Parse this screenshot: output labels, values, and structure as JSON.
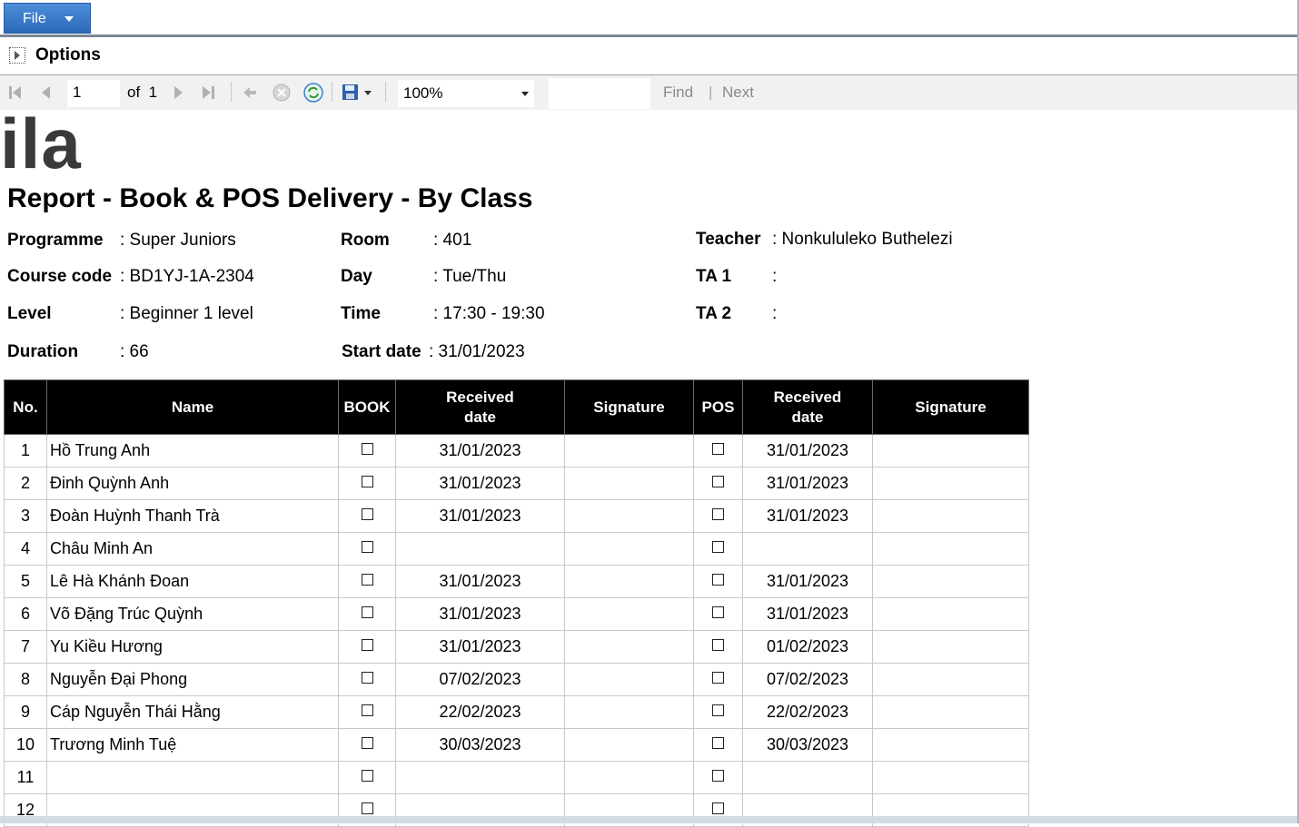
{
  "menu": {
    "file_label": "File"
  },
  "options": {
    "label": "Options"
  },
  "toolbar": {
    "page_current": "1",
    "page_of": "of",
    "page_total": "1",
    "zoom": "100%",
    "find_label": "Find",
    "find_sep": "|",
    "next_label": "Next"
  },
  "report": {
    "logo": "ila",
    "title": "Report - Book & POS Delivery - By Class",
    "info": {
      "programme_label": "Programme",
      "programme_value": ": Super Juniors",
      "course_label": "Course code",
      "course_value": ": BD1YJ-1A-2304",
      "level_label": "Level",
      "level_value": ": Beginner 1 level",
      "duration_label": "Duration",
      "duration_value": ": 66",
      "room_label": "Room",
      "room_value": ": 401",
      "day_label": "Day",
      "day_value": ": Tue/Thu",
      "time_label": "Time",
      "time_value": ": 17:30 - 19:30",
      "start_label": "Start date",
      "start_value": ": 31/01/2023",
      "teacher_label": "Teacher",
      "teacher_value": ": Nonkululeko Buthelezi",
      "ta1_label": "TA 1",
      "ta1_value": ":",
      "ta2_label": "TA 2",
      "ta2_value": ":"
    },
    "columns": {
      "no": "No.",
      "name": "Name",
      "book": "BOOK",
      "received1_a": "Received",
      "received1_b": "date",
      "signature1": "Signature",
      "pos": "POS",
      "received2_a": "Received",
      "received2_b": "date",
      "signature2": "Signature"
    },
    "rows": [
      {
        "no": "1",
        "name": "Hồ Trung Anh",
        "book_date": "31/01/2023",
        "pos_date": "31/01/2023"
      },
      {
        "no": "2",
        "name": "Đinh Quỳnh Anh",
        "book_date": "31/01/2023",
        "pos_date": "31/01/2023"
      },
      {
        "no": "3",
        "name": "Đoàn Huỳnh Thanh Trà",
        "book_date": "31/01/2023",
        "pos_date": "31/01/2023"
      },
      {
        "no": "4",
        "name": "Châu Minh An",
        "book_date": "",
        "pos_date": ""
      },
      {
        "no": "5",
        "name": "Lê Hà Khánh Đoan",
        "book_date": "31/01/2023",
        "pos_date": "31/01/2023"
      },
      {
        "no": "6",
        "name": "Võ Đặng Trúc Quỳnh",
        "book_date": "31/01/2023",
        "pos_date": "31/01/2023"
      },
      {
        "no": "7",
        "name": "Yu Kiều Hương",
        "book_date": "31/01/2023",
        "pos_date": "01/02/2023"
      },
      {
        "no": "8",
        "name": "Nguyễn Đại Phong",
        "book_date": "07/02/2023",
        "pos_date": "07/02/2023"
      },
      {
        "no": "9",
        "name": "Cáp Nguyễn Thái Hằng",
        "book_date": "22/02/2023",
        "pos_date": "22/02/2023"
      },
      {
        "no": "10",
        "name": "Trương Minh Tuệ",
        "book_date": "30/03/2023",
        "pos_date": "30/03/2023"
      },
      {
        "no": "11",
        "name": "",
        "book_date": "",
        "pos_date": ""
      },
      {
        "no": "12",
        "name": "",
        "book_date": "",
        "pos_date": ""
      }
    ]
  }
}
